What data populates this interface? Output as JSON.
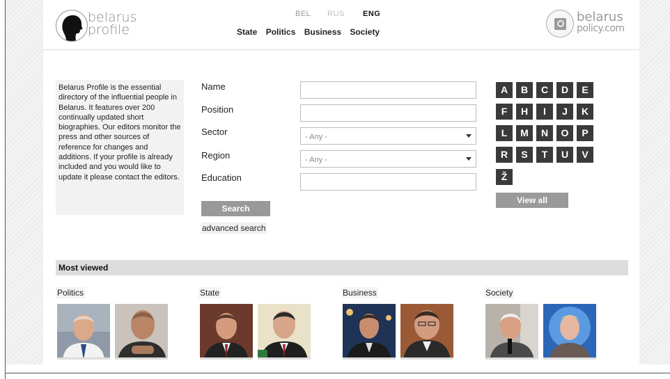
{
  "header": {
    "logo_left": [
      "belarus",
      "profile"
    ],
    "logo_right": [
      "belarus",
      "policy.com"
    ],
    "languages": [
      "BEL",
      "RUS",
      "ENG"
    ],
    "nav": [
      "State",
      "Politics",
      "Business",
      "Society"
    ]
  },
  "intro_text": "Belarus Profile is the essential directory of the influential people in Belarus. It features over 200 continually updated short biographies. Our editors monitor the press and other sources of reference for changes and additions. If your profile is already included and you would like to update it please contact the editors.",
  "form": {
    "labels": [
      "Name",
      "Position",
      "Sector",
      "Region",
      "Education"
    ],
    "sector_value": "- Any -",
    "region_value": "- Any -",
    "search_label": "Search",
    "advanced_label": "advanced search"
  },
  "alphabet": [
    "A",
    "B",
    "C",
    "D",
    "E",
    "F",
    "H",
    "I",
    "J",
    "K",
    "L",
    "M",
    "N",
    "O",
    "P",
    "R",
    "S",
    "T",
    "U",
    "V",
    "Ž"
  ],
  "view_all_label": "View all",
  "most_viewed": {
    "title": "Most viewed",
    "categories": [
      "Politics",
      "State",
      "Business",
      "Society"
    ]
  }
}
